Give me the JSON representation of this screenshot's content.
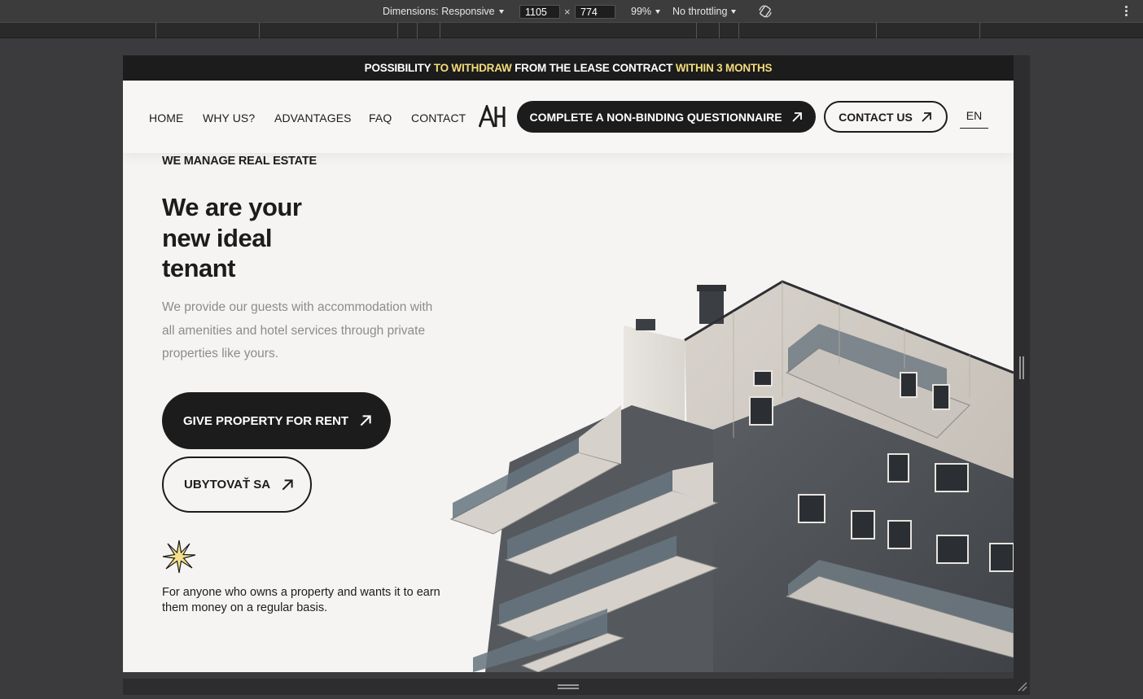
{
  "devtools": {
    "dimensions_label": "Dimensions: Responsive",
    "width_value": "1105",
    "times": "×",
    "height_value": "774",
    "zoom": "99%",
    "throttling": "No throttling"
  },
  "announcement": {
    "part1": "POSSIBILITY ",
    "part2": "TO WITHDRAW",
    "part3": " FROM THE LEASE CONTRACT ",
    "part4": "WITHIN 3 MONTHS"
  },
  "nav": {
    "links": [
      "HOME",
      "WHY US?",
      "ADVANTAGES",
      "FAQ",
      "CONTACT"
    ],
    "questionnaire_button": "COMPLETE A NON-BINDING QUESTIONNAIRE",
    "contact_button": "CONTACT US",
    "language": "EN"
  },
  "hero": {
    "eyebrow": "WE MANAGE REAL ESTATE",
    "headline_line1": "We are your",
    "headline_line2": "new ideal",
    "headline_line3": "tenant",
    "lede": "We provide our guests with accommodation with all amenities and hotel services through private properties like yours.",
    "cta_primary": "GIVE PROPERTY FOR RENT",
    "cta_secondary": "UBYTOVAŤ SA",
    "tagline": "For anyone who owns a property and wants it to earn them money on a regular basis."
  },
  "colors": {
    "dark": "#1c1c1c",
    "accent_yellow": "#f3dc7a",
    "page_bg": "#f5f4f2",
    "muted_text": "#8c8c8c"
  },
  "icons": {
    "arrow": "arrow-up-right-icon",
    "star": "sparkle-star-icon",
    "rotate": "rotate-device-icon",
    "menu": "kebab-menu-icon"
  }
}
